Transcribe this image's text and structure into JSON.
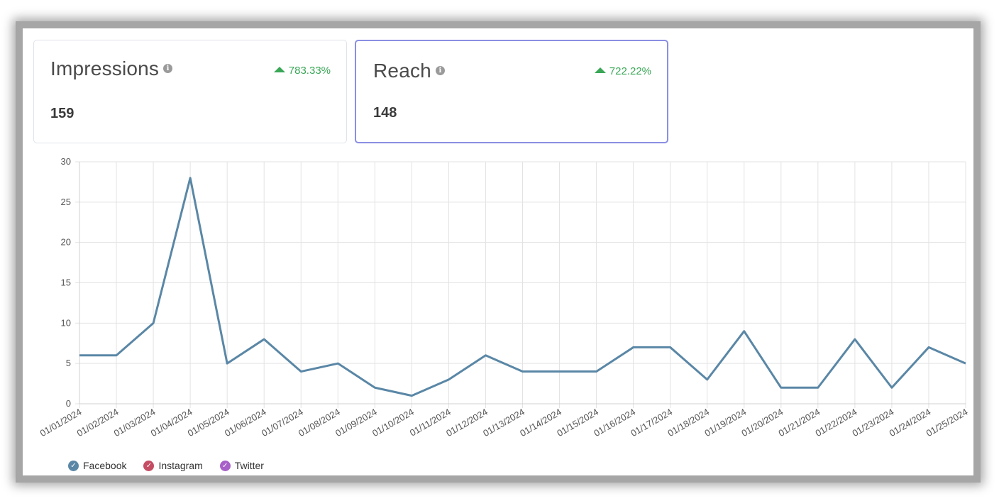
{
  "cards": [
    {
      "title": "Impressions",
      "value": "159",
      "change": "783.33%",
      "trend": "up"
    },
    {
      "title": "Reach",
      "value": "148",
      "change": "722.22%",
      "trend": "up"
    }
  ],
  "colors": {
    "accent": "#8a8fe3",
    "positive": "#3aa757",
    "facebook": "#5a87a6",
    "instagram": "#c44c63",
    "twitter": "#a760c8"
  },
  "legend": [
    {
      "label": "Facebook",
      "color": "#5a87a6"
    },
    {
      "label": "Instagram",
      "color": "#c44c63"
    },
    {
      "label": "Twitter",
      "color": "#a760c8"
    }
  ],
  "chart_data": {
    "type": "line",
    "x": [
      "01/01/2024",
      "01/02/2024",
      "01/03/2024",
      "01/04/2024",
      "01/05/2024",
      "01/06/2024",
      "01/07/2024",
      "01/08/2024",
      "01/09/2024",
      "01/10/2024",
      "01/11/2024",
      "01/12/2024",
      "01/13/2024",
      "01/14/2024",
      "01/15/2024",
      "01/16/2024",
      "01/17/2024",
      "01/18/2024",
      "01/19/2024",
      "01/20/2024",
      "01/21/2024",
      "01/22/2024",
      "01/23/2024",
      "01/24/2024",
      "01/25/2024"
    ],
    "series": [
      {
        "name": "Facebook",
        "color": "#5a87a6",
        "values": [
          6,
          6,
          10,
          28,
          5,
          8,
          4,
          5,
          2,
          1,
          3,
          6,
          4,
          4,
          4,
          7,
          7,
          3,
          9,
          2,
          2,
          8,
          2,
          7,
          5
        ]
      },
      {
        "name": "Instagram",
        "color": "#c44c63",
        "values": []
      },
      {
        "name": "Twitter",
        "color": "#a760c8",
        "values": []
      }
    ],
    "yticks": [
      "0",
      "5",
      "10",
      "15",
      "20",
      "25",
      "30"
    ],
    "ylim": [
      0,
      30
    ],
    "grid": true,
    "legend_position": "bottom-left"
  }
}
